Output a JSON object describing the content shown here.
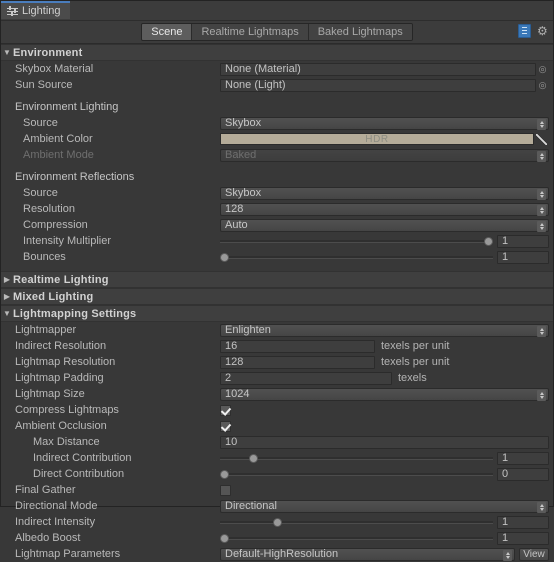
{
  "window": {
    "tab_label": "Lighting",
    "tab_icon": "lighting-sliders-icon"
  },
  "toolbar": {
    "tabs": [
      {
        "label": "Scene",
        "selected": true
      },
      {
        "label": "Realtime Lightmaps",
        "selected": false
      },
      {
        "label": "Baked Lightmaps",
        "selected": false
      }
    ],
    "book_icon": "lightmap-book-icon",
    "gear_icon": "gear-icon",
    "gear_glyph": "⚙"
  },
  "sections": {
    "environment": {
      "title": "Environment",
      "expanded": true,
      "triangle": "▼"
    },
    "realtime_lighting": {
      "title": "Realtime Lighting",
      "expanded": false,
      "triangle": "▶"
    },
    "mixed_lighting": {
      "title": "Mixed Lighting",
      "expanded": false,
      "triangle": "▶"
    },
    "lightmapping_settings": {
      "title": "Lightmapping Settings",
      "expanded": true,
      "triangle": "▼"
    }
  },
  "environment": {
    "skybox_material": {
      "label": "Skybox Material",
      "value": "None (Material)"
    },
    "sun_source": {
      "label": "Sun Source",
      "value": "None (Light)"
    },
    "environment_lighting": {
      "group_label": "Environment Lighting",
      "source": {
        "label": "Source",
        "value": "Skybox"
      },
      "ambient_color": {
        "label": "Ambient Color",
        "value": "HDR",
        "color": "#b5ac99"
      },
      "ambient_mode": {
        "label": "Ambient Mode",
        "value": "Baked",
        "disabled": true
      }
    },
    "environment_reflections": {
      "group_label": "Environment Reflections",
      "source": {
        "label": "Source",
        "value": "Skybox"
      },
      "resolution": {
        "label": "Resolution",
        "value": "128"
      },
      "compression": {
        "label": "Compression",
        "value": "Auto"
      },
      "intensity_multiplier": {
        "label": "Intensity Multiplier",
        "value": "1",
        "slider_pct": 100
      },
      "bounces": {
        "label": "Bounces",
        "value": "1",
        "slider_pct": 0
      }
    }
  },
  "lightmapping": {
    "lightmapper": {
      "label": "Lightmapper",
      "value": "Enlighten"
    },
    "indirect_resolution": {
      "label": "Indirect Resolution",
      "value": "16",
      "unit": "texels per unit"
    },
    "lightmap_resolution": {
      "label": "Lightmap Resolution",
      "value": "128",
      "unit": "texels per unit"
    },
    "lightmap_padding": {
      "label": "Lightmap Padding",
      "value": "2",
      "unit": "texels"
    },
    "lightmap_size": {
      "label": "Lightmap Size",
      "value": "1024"
    },
    "compress_lightmaps": {
      "label": "Compress Lightmaps",
      "checked": true
    },
    "ambient_occlusion": {
      "label": "Ambient Occlusion",
      "checked": true
    },
    "max_distance": {
      "label": "Max Distance",
      "value": "10"
    },
    "indirect_contribution": {
      "label": "Indirect Contribution",
      "value": "1",
      "slider_pct": 11
    },
    "direct_contribution": {
      "label": "Direct Contribution",
      "value": "0",
      "slider_pct": 0
    },
    "final_gather": {
      "label": "Final Gather",
      "checked": false
    },
    "directional_mode": {
      "label": "Directional Mode",
      "value": "Directional"
    },
    "indirect_intensity": {
      "label": "Indirect Intensity",
      "value": "1",
      "slider_pct": 20
    },
    "albedo_boost": {
      "label": "Albedo Boost",
      "value": "1",
      "slider_pct": 0
    },
    "lightmap_parameters": {
      "label": "Lightmap Parameters",
      "value": "Default-HighResolution",
      "view_label": "View"
    }
  }
}
